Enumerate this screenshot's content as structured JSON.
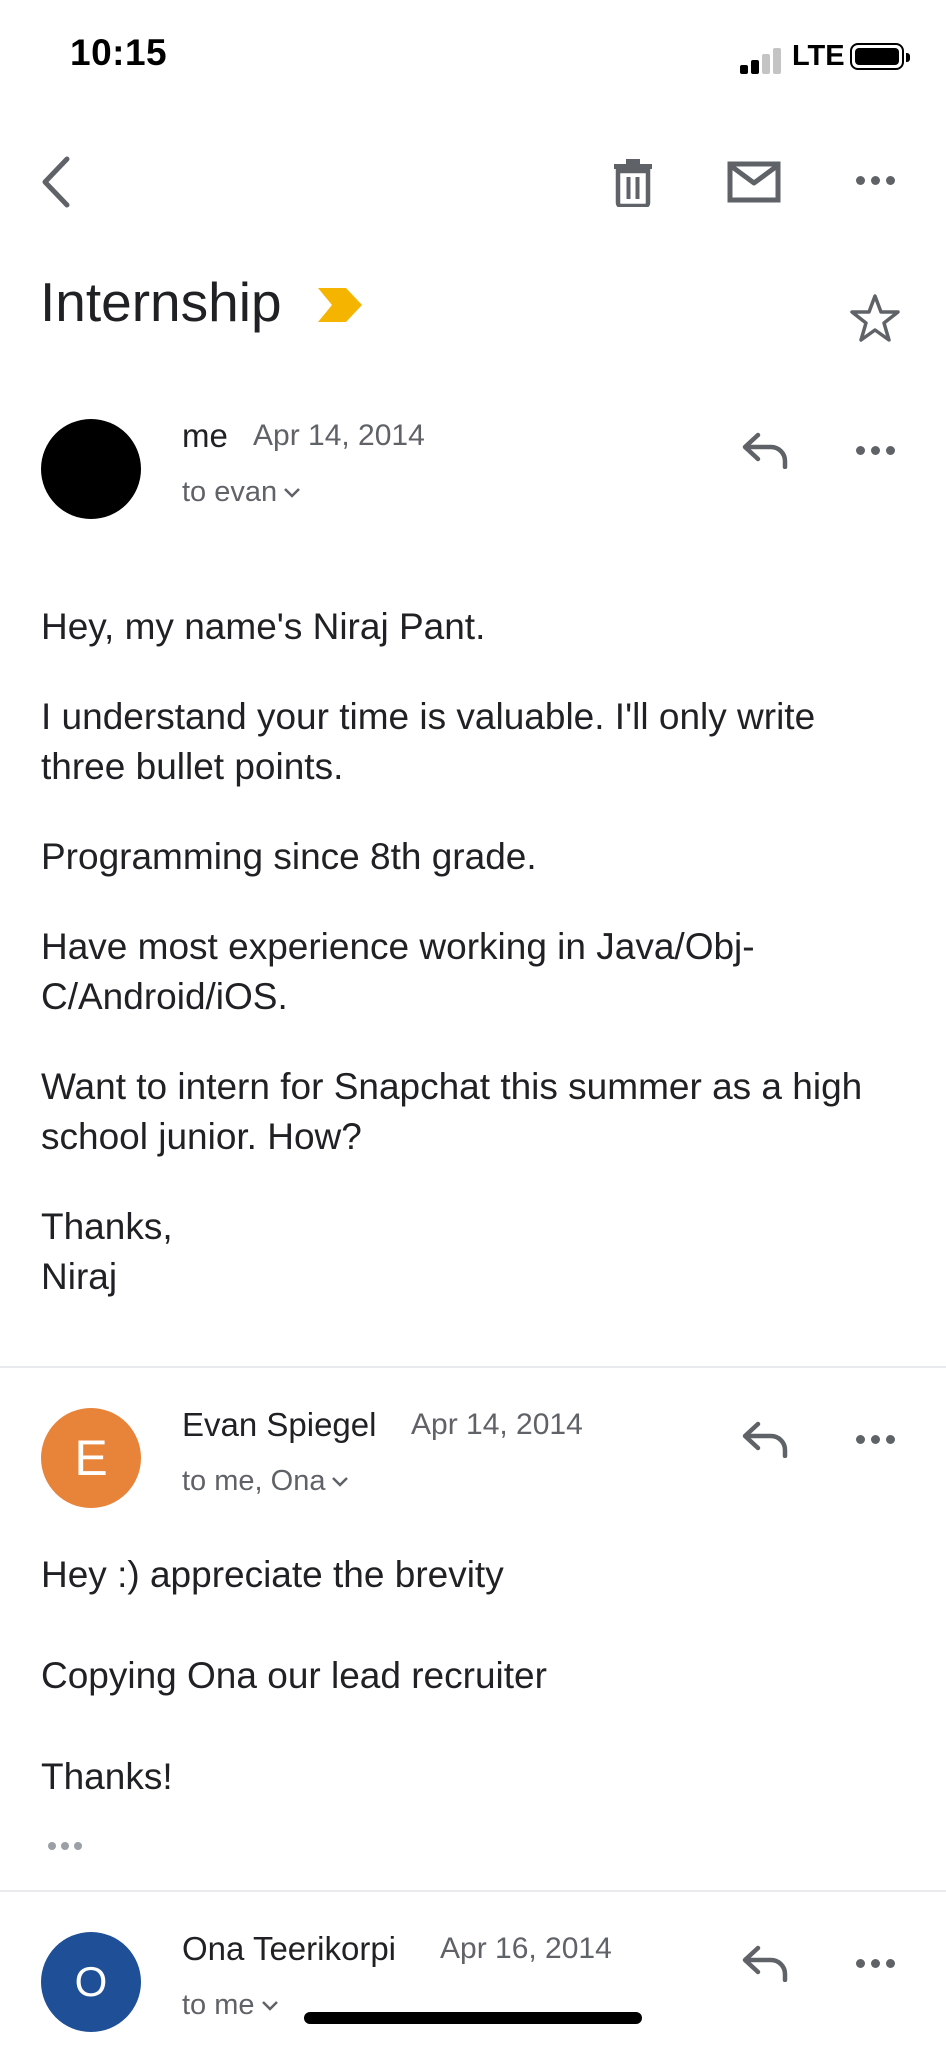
{
  "status_bar": {
    "time": "10:15",
    "network": "LTE"
  },
  "toolbar": {
    "back_icon": "chevron-left-icon",
    "delete_icon": "trash-icon",
    "mark_unread_icon": "envelope-icon",
    "more_icon": "more-horizontal-icon"
  },
  "subject": {
    "text": "Internship",
    "label_icon": "important-marker-icon",
    "label_color": "#f4b400"
  },
  "messages": [
    {
      "sender": "me",
      "date": "Apr 14, 2014",
      "to": "to evan",
      "avatar_letter": "",
      "avatar_color": "#000000",
      "body": [
        "Hey, my name's Niraj Pant.",
        "I understand your time is valuable. I'll only write three bullet points.",
        "Programming since 8th grade.",
        "Have most experience working in Java/Obj-C/Android/iOS.",
        "Want to intern for Snapchat this summer as a high school junior. How?",
        "Thanks,",
        "Niraj"
      ]
    },
    {
      "sender": "Evan Spiegel",
      "date": "Apr 14, 2014",
      "to": "to me, Ona",
      "avatar_letter": "E",
      "avatar_color": "#e8833a",
      "body": [
        "Hey :) appreciate the brevity",
        "Copying Ona our lead recruiter",
        "Thanks!"
      ]
    },
    {
      "sender": "Ona Teerikorpi",
      "date": "Apr 16, 2014",
      "to": "to me",
      "avatar_letter": "O",
      "avatar_color": "#1e4f97"
    }
  ]
}
